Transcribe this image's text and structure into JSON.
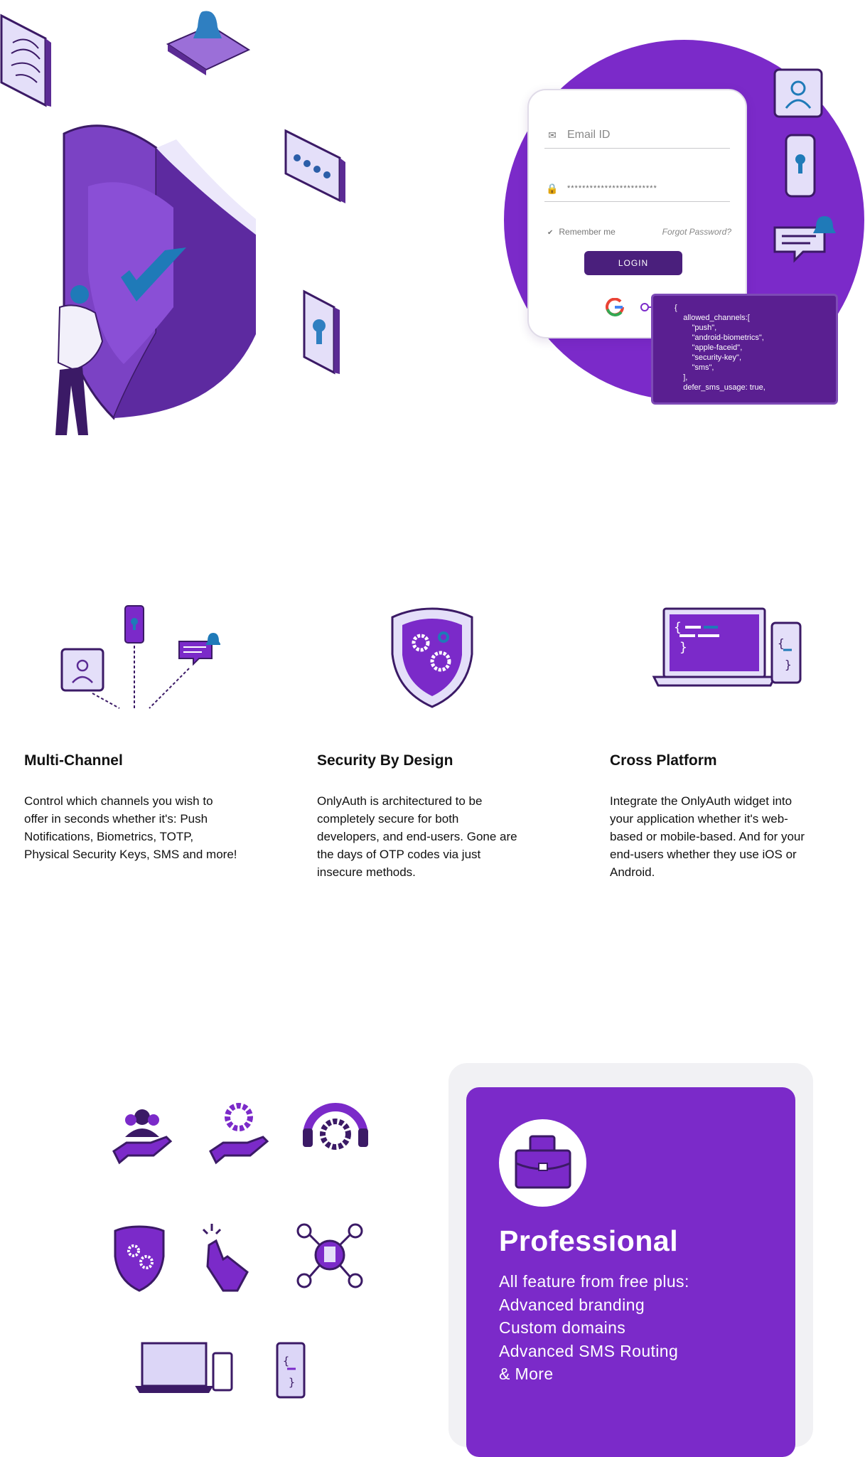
{
  "hero": {
    "login": {
      "email_placeholder": "Email ID",
      "password_mask": "************************",
      "remember_label": "Remember me",
      "forgot_label": "Forgot Password?",
      "login_button": "LOGIN"
    },
    "code_lines": [
      "{",
      "    allowed_channels:[",
      "        \"push\",",
      "        \"android-biometrics\",",
      "        \"apple-faceid\",",
      "        \"security-key\",",
      "        \"sms\",",
      "    ],",
      "    defer_sms_usage: true,"
    ]
  },
  "features": [
    {
      "title": "Multi-Channel",
      "lines": [
        "Control which channels you wish to",
        "offer in seconds whether it's: Push",
        "Notifications, Biometrics, TOTP,",
        "Physical Security Keys, SMS and more!"
      ]
    },
    {
      "title": "Security By Design",
      "lines": [
        "OnlyAuth is architectured to be",
        "completely secure for both",
        "developers, and end-users. Gone are",
        "the days of OTP codes via just",
        "insecure methods."
      ]
    },
    {
      "title": "Cross Platform",
      "lines": [
        "Integrate the OnlyAuth widget into",
        "your application whether it's web-",
        "based or mobile-based. And for your",
        "end-users whether they use iOS or",
        "Android."
      ]
    }
  ],
  "plan": {
    "name": "Professional",
    "features": [
      "All feature from free plus:",
      "Advanced branding",
      "Custom domains",
      "Advanced SMS Routing",
      "& More"
    ]
  },
  "colors": {
    "brand_purple": "#7b2ac9",
    "dark_purple": "#4a1f7c",
    "light_lavender": "#dcd6f7"
  }
}
